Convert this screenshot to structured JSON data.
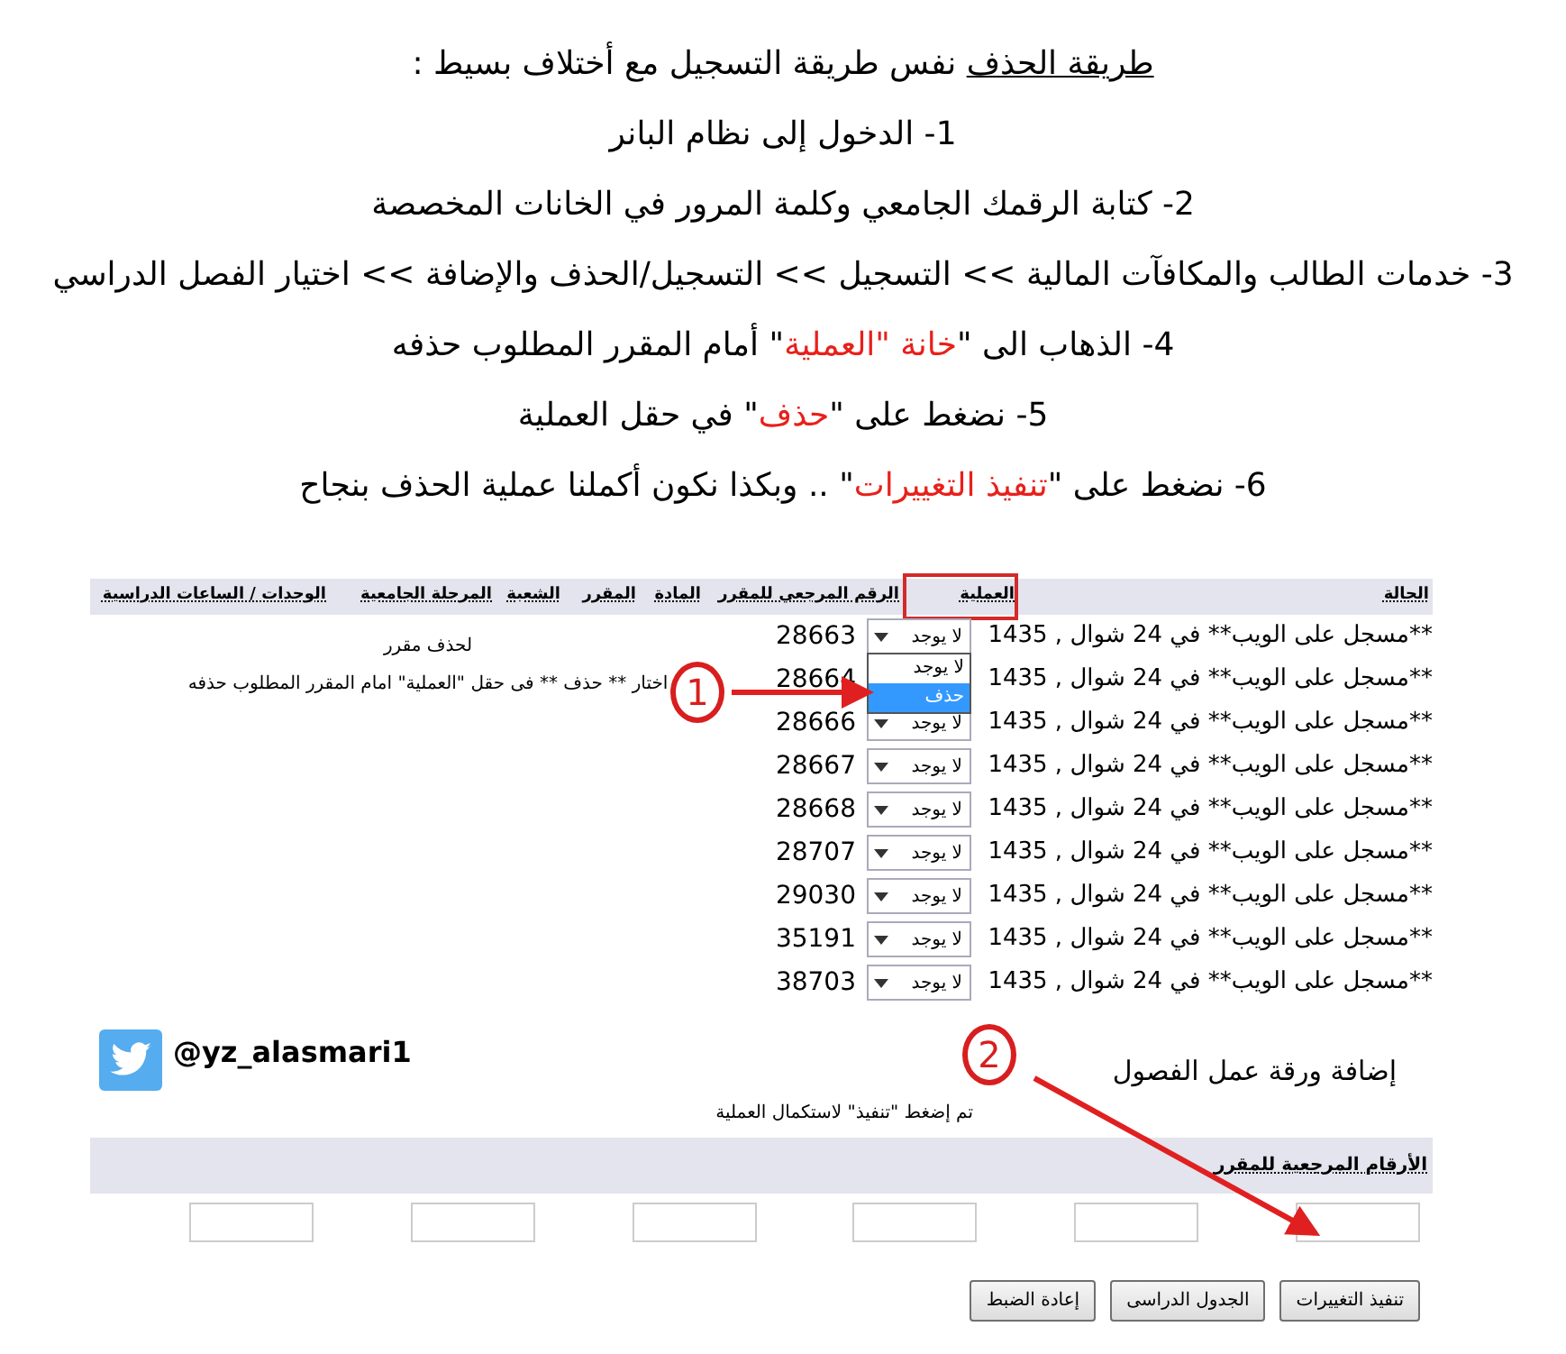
{
  "instructions": [
    {
      "segments": [
        {
          "kind": "underline",
          "text": "طريقة الحذف"
        },
        {
          "kind": "plain",
          "text": " نفس طريقة التسجيل مع أختلاف بسيط :"
        }
      ]
    },
    {
      "segments": [
        {
          "kind": "plain",
          "text": "1- الدخول إلى نظام البانر"
        }
      ]
    },
    {
      "segments": [
        {
          "kind": "plain",
          "text": "2- كتابة الرقمك الجامعي وكلمة المرور في الخانات المخصصة"
        }
      ]
    },
    {
      "segments": [
        {
          "kind": "plain",
          "text": "3- خدمات الطالب والمكافآت المالية >> التسجيل >> التسجيل/الحذف والإضافة >> اختيار الفصل الدراسي"
        }
      ]
    },
    {
      "segments": [
        {
          "kind": "plain",
          "text": "4- الذهاب الى \""
        },
        {
          "kind": "red",
          "text": "خانة \"العملية"
        },
        {
          "kind": "plain",
          "text": "\" أمام المقرر المطلوب حذفه"
        }
      ]
    },
    {
      "segments": [
        {
          "kind": "plain",
          "text": "5- نضغط على \""
        },
        {
          "kind": "red",
          "text": "حذف"
        },
        {
          "kind": "plain",
          "text": "\" في حقل العملية"
        }
      ]
    },
    {
      "segments": [
        {
          "kind": "plain",
          "text": "6- نضغط على \""
        },
        {
          "kind": "red",
          "text": "تنفيذ التغييرات"
        },
        {
          "kind": "plain",
          "text": "\" .. وبكذا نكون أكملنا عملية الحذف بنجاح"
        }
      ]
    }
  ],
  "table": {
    "columns": [
      {
        "label": "الحالة",
        "highlighted": false
      },
      {
        "label": "العملية",
        "highlighted": true
      },
      {
        "label": "الرقم المرجعي للمقرر",
        "highlighted": false
      },
      {
        "label": "المادة",
        "highlighted": false
      },
      {
        "label": "المقرر",
        "highlighted": false
      },
      {
        "label": "الشعبة",
        "highlighted": false
      },
      {
        "label": "المرحلة الجامعية",
        "highlighted": false
      },
      {
        "label": "الوحدات / الساعات الدراسية",
        "highlighted": false
      }
    ],
    "rows": [
      {
        "status": "**مسجل على الويب** في 24 شوال , 1435",
        "operation": "لا يوجد",
        "crn": "28663"
      },
      {
        "status": "**مسجل على الويب** في 24 شوال , 1435",
        "crn": "28664"
      },
      {
        "status": "**مسجل على الويب** في 24 شوال , 1435",
        "operation": "لا يوجد",
        "crn": "28666"
      },
      {
        "status": "**مسجل على الويب** في 24 شوال , 1435",
        "operation": "لا يوجد",
        "crn": "28667"
      },
      {
        "status": "**مسجل على الويب** في 24 شوال , 1435",
        "operation": "لا يوجد",
        "crn": "28668"
      },
      {
        "status": "**مسجل على الويب** في 24 شوال , 1435",
        "operation": "لا يوجد",
        "crn": "28707"
      },
      {
        "status": "**مسجل على الويب** في 24 شوال , 1435",
        "operation": "لا يوجد",
        "crn": "29030"
      },
      {
        "status": "**مسجل على الويب** في 24 شوال , 1435",
        "operation": "لا يوجد",
        "crn": "35191"
      },
      {
        "status": "**مسجل على الويب** في 24 شوال , 1435",
        "operation": "لا يوجد",
        "crn": "38703"
      }
    ],
    "open_dropdown": {
      "options": [
        {
          "label": "لا يوجد",
          "selected": false
        },
        {
          "label": "حذف",
          "selected": true
        }
      ]
    }
  },
  "notes": [
    "لحذف مقرر",
    "اختار ** حذف ** فى حقل \"العملية\"  امام المقرر المطلوب حذفه"
  ],
  "annotations": [
    {
      "label": "1"
    },
    {
      "label": "2"
    }
  ],
  "twitter_handle": "@yz_alasmari1",
  "worksheet": {
    "title": "إضافة ورقة عمل الفصول",
    "note": "تم إضغط \"تنفيذ\" لاستكمال العملية",
    "header": "الأرقام المرجعية للمقرر",
    "fields": [
      {
        "kind": "text"
      },
      {
        "kind": "text"
      },
      {
        "kind": "text"
      },
      {
        "kind": "text"
      },
      {
        "kind": "text"
      },
      {
        "kind": "text"
      }
    ]
  },
  "buttons": [
    "تنفيذ التغييرات",
    "الجدول الدراسى",
    "إعادة الضبط"
  ]
}
